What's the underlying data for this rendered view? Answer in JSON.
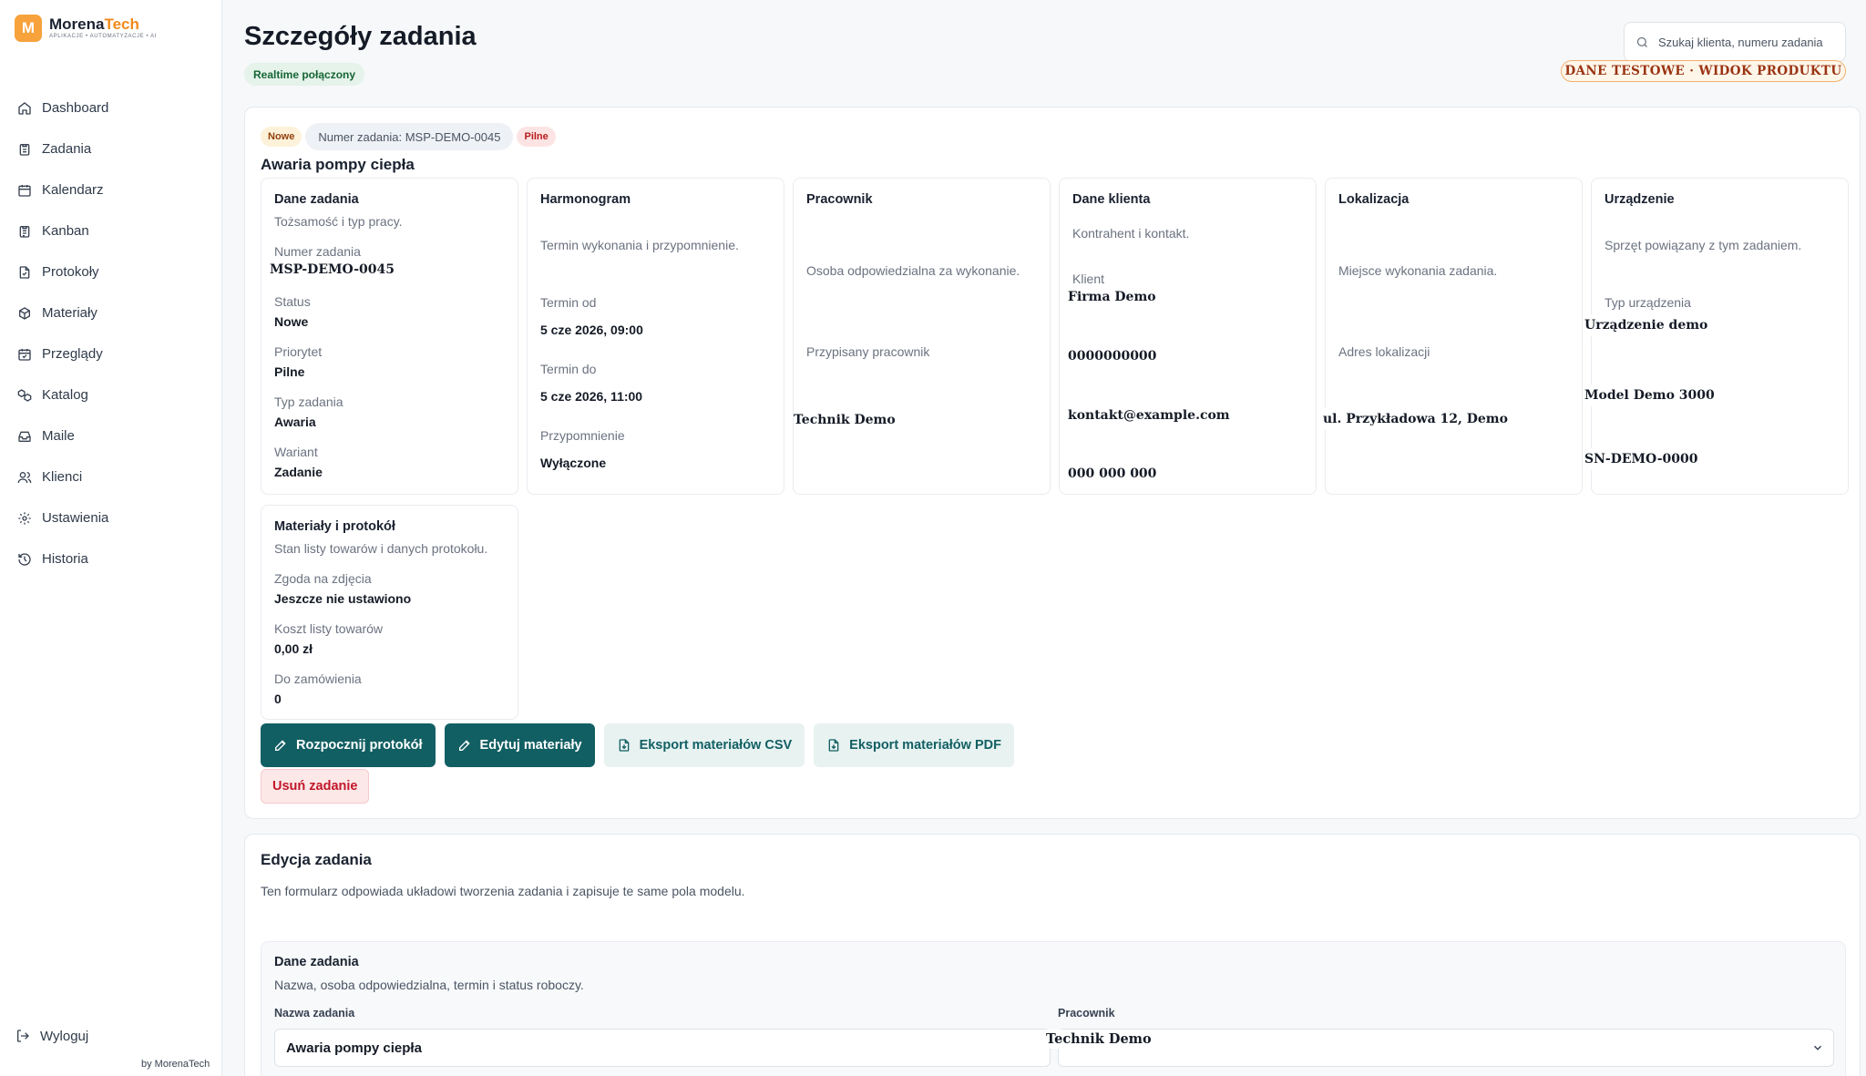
{
  "brand": {
    "initial": "M",
    "name_a": "Morena",
    "name_b": "Tech",
    "tagline": "APLIKACJE • AUTOMATYZACJE • AI"
  },
  "sidebar": {
    "items": [
      {
        "label": "Dashboard",
        "icon": "home-icon"
      },
      {
        "label": "Zadania",
        "icon": "clipboard-icon"
      },
      {
        "label": "Kalendarz",
        "icon": "calendar-icon"
      },
      {
        "label": "Kanban",
        "icon": "clipboard-list-icon"
      },
      {
        "label": "Protokoły",
        "icon": "file-check-icon"
      },
      {
        "label": "Materiały",
        "icon": "package-icon"
      },
      {
        "label": "Przeglądy",
        "icon": "calendar-check-icon"
      },
      {
        "label": "Katalog",
        "icon": "boxes-icon"
      },
      {
        "label": "Maile",
        "icon": "inbox-icon"
      },
      {
        "label": "Klienci",
        "icon": "users-icon"
      },
      {
        "label": "Ustawienia",
        "icon": "gear-icon"
      },
      {
        "label": "Historia",
        "icon": "history-icon"
      }
    ],
    "logout": "Wyloguj",
    "byline": "by MorenaTech"
  },
  "header": {
    "title": "Szczegóły zadania",
    "realtime": "Realtime połączony",
    "search_placeholder": "Szukaj klienta, numeru zadania",
    "test_badge": "DANE TESTOWE · WIDOK PRODUKTU"
  },
  "task": {
    "badge_status": "Nowe",
    "badge_number": "Numer zadania: MSP-DEMO-0045",
    "badge_priority": "Pilne",
    "title": "Awaria pompy ciepła"
  },
  "panels": {
    "details": {
      "title": "Dane zadania",
      "desc": "Tożsamość i typ pracy.",
      "number_label": "Numer zadania",
      "number": "MSP-DEMO-0045",
      "status_label": "Status",
      "status": "Nowe",
      "priority_label": "Priorytet",
      "priority": "Pilne",
      "type_label": "Typ zadania",
      "type": "Awaria",
      "variant_label": "Wariant",
      "variant": "Zadanie"
    },
    "schedule": {
      "title": "Harmonogram",
      "desc": "Termin wykonania i przypomnienie.",
      "from_label": "Termin od",
      "from": "5 cze 2026, 09:00",
      "to_label": "Termin do",
      "to": "5 cze 2026, 11:00",
      "reminder_label": "Przypomnienie",
      "reminder": "Wyłączone"
    },
    "worker": {
      "title": "Pracownik",
      "desc": "Osoba odpowiedzialna za wykonanie.",
      "assigned_label": "Przypisany pracownik",
      "assigned": "Technik Demo"
    },
    "client": {
      "title": "Dane klienta",
      "desc": "Kontrahent i kontakt.",
      "client_label": "Klient",
      "name": "Firma Demo",
      "nip": "0000000000",
      "email": "kontakt@example.com",
      "phone": "000 000 000"
    },
    "location": {
      "title": "Lokalizacja",
      "desc": "Miejsce wykonania zadania.",
      "address_label": "Adres lokalizacji",
      "address": "ul. Przykładowa 12, Demo"
    },
    "device": {
      "title": "Urządzenie",
      "desc": "Sprzęt powiązany z tym zadaniem.",
      "type_label": "Typ urządzenia",
      "name": "Urządzenie demo",
      "model": "Model Demo 3000",
      "serial": "SN-DEMO-0000"
    },
    "materials": {
      "title": "Materiały i protokół",
      "desc": "Stan listy towarów i danych protokołu.",
      "consent_label": "Zgoda na zdjęcia",
      "consent": "Jeszcze nie ustawiono",
      "cost_label": "Koszt listy towarów",
      "cost": "0,00 zł",
      "order_label": "Do zamówienia",
      "order": "0"
    }
  },
  "actions": {
    "start_protocol": "Rozpocznij protokół",
    "edit_materials": "Edytuj materiały",
    "export_csv": "Eksport materiałów CSV",
    "export_pdf": "Eksport materiałów PDF",
    "delete": "Usuń zadanie"
  },
  "edit": {
    "title": "Edycja zadania",
    "desc": "Ten formularz odpowiada układowi tworzenia zadania i zapisuje te same pola modelu.",
    "section_title": "Dane zadania",
    "section_desc": "Nazwa, osoba odpowiedzialna, termin i status roboczy.",
    "name_label": "Nazwa zadania",
    "name_value": "Awaria pompy ciepła",
    "worker_label": "Pracownik",
    "worker_value": "Technik Demo"
  },
  "colors": {
    "accent": "#125f63",
    "brand_orange": "#f7a23b",
    "danger": "#c0182a"
  }
}
